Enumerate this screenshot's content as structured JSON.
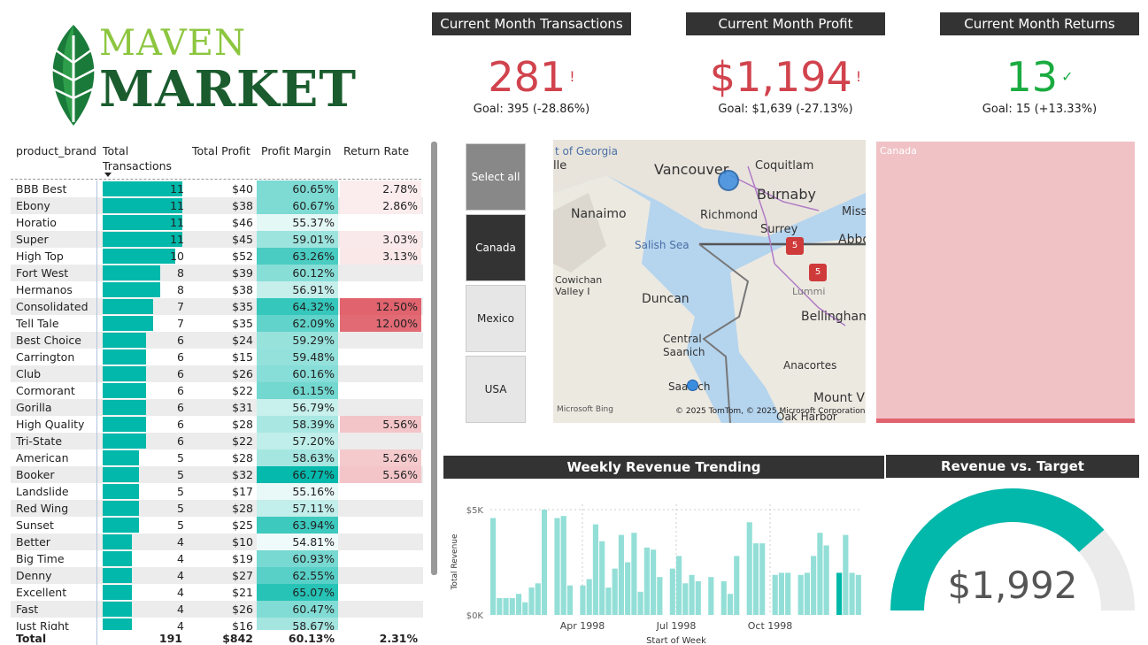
{
  "logo": {
    "line1": "MAVEN",
    "line2": "MARKET"
  },
  "kpis": [
    {
      "title": "Current Month Transactions",
      "value": "281",
      "flag": "!",
      "goal": "Goal: 395 (-28.86%)",
      "color": "#d1434d"
    },
    {
      "title": "Current Month Profit",
      "value": "$1,194",
      "flag": "!",
      "goal": "Goal: $1,639 (-27.13%)",
      "color": "#d1434d"
    },
    {
      "title": "Current Month Returns",
      "value": "13",
      "flag": "✓",
      "goal": "Goal: 15 (+13.33%)",
      "color": "#1aab40"
    }
  ],
  "table": {
    "headers": {
      "brand": "product_brand",
      "tx": "Total Transactions",
      "profit": "Total Profit",
      "margin": "Profit Margin",
      "returns": "Return Rate"
    },
    "rows": [
      {
        "brand": "BBB Best",
        "tx": 11,
        "profit": "$40",
        "margin": "60.65%",
        "returns": "2.78%"
      },
      {
        "brand": "Ebony",
        "tx": 11,
        "profit": "$38",
        "margin": "60.67%",
        "returns": "2.86%"
      },
      {
        "brand": "Horatio",
        "tx": 11,
        "profit": "$46",
        "margin": "55.37%",
        "returns": ""
      },
      {
        "brand": "Super",
        "tx": 11,
        "profit": "$45",
        "margin": "59.01%",
        "returns": "3.03%"
      },
      {
        "brand": "High Top",
        "tx": 10,
        "profit": "$52",
        "margin": "63.26%",
        "returns": "3.13%"
      },
      {
        "brand": "Fort West",
        "tx": 8,
        "profit": "$39",
        "margin": "60.12%",
        "returns": ""
      },
      {
        "brand": "Hermanos",
        "tx": 8,
        "profit": "$38",
        "margin": "56.91%",
        "returns": ""
      },
      {
        "brand": "Consolidated",
        "tx": 7,
        "profit": "$35",
        "margin": "64.32%",
        "returns": "12.50%"
      },
      {
        "brand": "Tell Tale",
        "tx": 7,
        "profit": "$35",
        "margin": "62.09%",
        "returns": "12.00%"
      },
      {
        "brand": "Best Choice",
        "tx": 6,
        "profit": "$24",
        "margin": "59.29%",
        "returns": ""
      },
      {
        "brand": "Carrington",
        "tx": 6,
        "profit": "$15",
        "margin": "59.48%",
        "returns": ""
      },
      {
        "brand": "Club",
        "tx": 6,
        "profit": "$26",
        "margin": "60.16%",
        "returns": ""
      },
      {
        "brand": "Cormorant",
        "tx": 6,
        "profit": "$22",
        "margin": "61.15%",
        "returns": ""
      },
      {
        "brand": "Gorilla",
        "tx": 6,
        "profit": "$31",
        "margin": "56.79%",
        "returns": ""
      },
      {
        "brand": "High Quality",
        "tx": 6,
        "profit": "$28",
        "margin": "58.39%",
        "returns": "5.56%"
      },
      {
        "brand": "Tri-State",
        "tx": 6,
        "profit": "$22",
        "margin": "57.20%",
        "returns": ""
      },
      {
        "brand": "American",
        "tx": 5,
        "profit": "$28",
        "margin": "58.63%",
        "returns": "5.26%"
      },
      {
        "brand": "Booker",
        "tx": 5,
        "profit": "$32",
        "margin": "66.77%",
        "returns": "5.56%"
      },
      {
        "brand": "Landslide",
        "tx": 5,
        "profit": "$17",
        "margin": "55.16%",
        "returns": ""
      },
      {
        "brand": "Red Wing",
        "tx": 5,
        "profit": "$28",
        "margin": "57.11%",
        "returns": ""
      },
      {
        "brand": "Sunset",
        "tx": 5,
        "profit": "$25",
        "margin": "63.94%",
        "returns": ""
      },
      {
        "brand": "Better",
        "tx": 4,
        "profit": "$10",
        "margin": "54.81%",
        "returns": ""
      },
      {
        "brand": "Big Time",
        "tx": 4,
        "profit": "$19",
        "margin": "60.93%",
        "returns": ""
      },
      {
        "brand": "Denny",
        "tx": 4,
        "profit": "$27",
        "margin": "62.55%",
        "returns": ""
      },
      {
        "brand": "Excellent",
        "tx": 4,
        "profit": "$21",
        "margin": "65.07%",
        "returns": ""
      },
      {
        "brand": "Fast",
        "tx": 4,
        "profit": "$26",
        "margin": "60.47%",
        "returns": ""
      },
      {
        "brand": "Just Right",
        "tx": 4,
        "profit": "$16",
        "margin": "58.67%",
        "returns": ""
      }
    ],
    "total": {
      "label": "Total",
      "tx": "191",
      "profit": "$842",
      "margin": "60.13%",
      "returns": "2.31%"
    }
  },
  "slicer": {
    "items": [
      "Select all",
      "Canada",
      "Mexico",
      "USA"
    ],
    "selected": "Canada"
  },
  "map": {
    "places": [
      "t of Georgia",
      "lle",
      "Vancouver",
      "Coquitlam",
      "Burnaby",
      "Nanaimo",
      "Richmond",
      "Miss",
      "Surrey",
      "Salish Sea",
      "Abbo",
      "Cowichan Valley I",
      "Lummi",
      "Duncan",
      "Bellingham",
      "Central Saanich",
      "Anacortes",
      "Saanich",
      "Mount V",
      "Oak Harbor"
    ],
    "credit": "© 2025 TomTom, © 2025 Microsoft Corporation",
    "brand": "Microsoft Bing",
    "shields": [
      "5",
      "5"
    ]
  },
  "treemap": {
    "label": "Canada"
  },
  "weekly": {
    "title": "Weekly Revenue Trending"
  },
  "gauge": {
    "title": "Revenue vs. Target",
    "value": "$1,992",
    "fraction": 0.77
  },
  "chart_data": {
    "type": "bar",
    "title": "Weekly Revenue Trending",
    "xlabel": "Start of Week",
    "ylabel": "Total Revenue",
    "yticks": [
      "$0K",
      "$5K"
    ],
    "xticks": [
      "Apr 1998",
      "Jul 1998",
      "Oct 1998"
    ],
    "ylim": [
      0,
      5000
    ],
    "values": [
      4600,
      800,
      800,
      800,
      1000,
      600,
      1300,
      1500,
      5000,
      0,
      4600,
      4700,
      1400,
      0,
      1400,
      1700,
      4300,
      3500,
      1300,
      2200,
      3800,
      2500,
      3900,
      1100,
      3200,
      3100,
      1800,
      0,
      2200,
      2800,
      1500,
      1900,
      1600,
      0,
      1800,
      0,
      1600,
      1000,
      2800,
      0,
      4400,
      3400,
      3400,
      0,
      1900,
      2000,
      2000,
      0,
      1900,
      2000,
      2800,
      3900,
      3300,
      0,
      2000,
      3800,
      2000,
      1900
    ],
    "highlight_index": 54
  },
  "colors": {
    "accent": "#01b8aa",
    "bad": "#d1434d",
    "good": "#1aab40",
    "header": "#333333"
  }
}
